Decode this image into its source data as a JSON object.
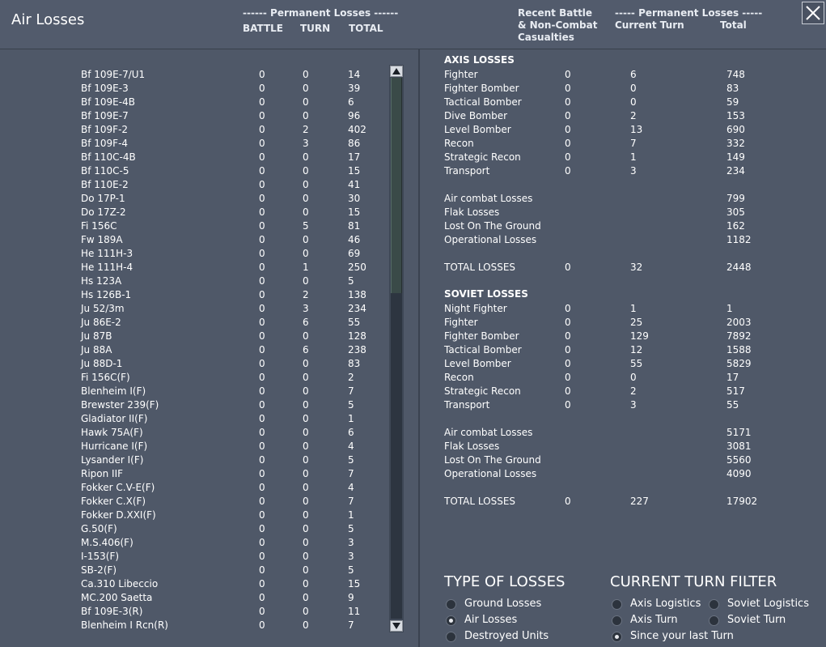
{
  "header": {
    "title": "Air Losses",
    "perm_losses_left": "------ Permanent Losses ------",
    "col_battle": "BATTLE",
    "col_turn": "TURN",
    "col_total": "TOTAL",
    "recent_line1": "Recent Battle",
    "recent_line2": "& Non-Combat",
    "recent_line3": "Casualties",
    "perm_losses_right": "----- Permanent Losses -----",
    "col_current_turn": "Current Turn",
    "col_total_right": "Total"
  },
  "aircraft": [
    {
      "name": "Bf 109E-7/U1",
      "battle": "0",
      "turn": "0",
      "total": "14"
    },
    {
      "name": "Bf 109E-3",
      "battle": "0",
      "turn": "0",
      "total": "39"
    },
    {
      "name": "Bf 109E-4B",
      "battle": "0",
      "turn": "0",
      "total": "6"
    },
    {
      "name": "Bf 109E-7",
      "battle": "0",
      "turn": "0",
      "total": "96"
    },
    {
      "name": "Bf 109F-2",
      "battle": "0",
      "turn": "2",
      "total": "402"
    },
    {
      "name": "Bf 109F-4",
      "battle": "0",
      "turn": "3",
      "total": "86"
    },
    {
      "name": "Bf 110C-4B",
      "battle": "0",
      "turn": "0",
      "total": "17"
    },
    {
      "name": "Bf 110C-5",
      "battle": "0",
      "turn": "0",
      "total": "15"
    },
    {
      "name": "Bf 110E-2",
      "battle": "0",
      "turn": "0",
      "total": "41"
    },
    {
      "name": "Do 17P-1",
      "battle": "0",
      "turn": "0",
      "total": "30"
    },
    {
      "name": "Do 17Z-2",
      "battle": "0",
      "turn": "0",
      "total": "15"
    },
    {
      "name": "Fi 156C",
      "battle": "0",
      "turn": "5",
      "total": "81"
    },
    {
      "name": "Fw 189A",
      "battle": "0",
      "turn": "0",
      "total": "46"
    },
    {
      "name": "He 111H-3",
      "battle": "0",
      "turn": "0",
      "total": "69"
    },
    {
      "name": "He 111H-4",
      "battle": "0",
      "turn": "1",
      "total": "250"
    },
    {
      "name": "Hs 123A",
      "battle": "0",
      "turn": "0",
      "total": "5"
    },
    {
      "name": "Hs 126B-1",
      "battle": "0",
      "turn": "2",
      "total": "138"
    },
    {
      "name": "Ju 52/3m",
      "battle": "0",
      "turn": "3",
      "total": "234"
    },
    {
      "name": "Ju 86E-2",
      "battle": "0",
      "turn": "6",
      "total": "55"
    },
    {
      "name": "Ju 87B",
      "battle": "0",
      "turn": "0",
      "total": "128"
    },
    {
      "name": "Ju 88A",
      "battle": "0",
      "turn": "6",
      "total": "238"
    },
    {
      "name": "Ju 88D-1",
      "battle": "0",
      "turn": "0",
      "total": "83"
    },
    {
      "name": "Fi 156C(F)",
      "battle": "0",
      "turn": "0",
      "total": "2"
    },
    {
      "name": "Blenheim I(F)",
      "battle": "0",
      "turn": "0",
      "total": "7"
    },
    {
      "name": "Brewster 239(F)",
      "battle": "0",
      "turn": "0",
      "total": "5"
    },
    {
      "name": "Gladiator II(F)",
      "battle": "0",
      "turn": "0",
      "total": "1"
    },
    {
      "name": "Hawk 75A(F)",
      "battle": "0",
      "turn": "0",
      "total": "6"
    },
    {
      "name": "Hurricane I(F)",
      "battle": "0",
      "turn": "0",
      "total": "4"
    },
    {
      "name": "Lysander I(F)",
      "battle": "0",
      "turn": "0",
      "total": "5"
    },
    {
      "name": "Ripon IIF",
      "battle": "0",
      "turn": "0",
      "total": "7"
    },
    {
      "name": "Fokker C.V-E(F)",
      "battle": "0",
      "turn": "0",
      "total": "4"
    },
    {
      "name": "Fokker C.X(F)",
      "battle": "0",
      "turn": "0",
      "total": "7"
    },
    {
      "name": "Fokker D.XXI(F)",
      "battle": "0",
      "turn": "0",
      "total": "1"
    },
    {
      "name": "G.50(F)",
      "battle": "0",
      "turn": "0",
      "total": "5"
    },
    {
      "name": "M.S.406(F)",
      "battle": "0",
      "turn": "0",
      "total": "3"
    },
    {
      "name": "I-153(F)",
      "battle": "0",
      "turn": "0",
      "total": "3"
    },
    {
      "name": "SB-2(F)",
      "battle": "0",
      "turn": "0",
      "total": "5"
    },
    {
      "name": "Ca.310 Libeccio",
      "battle": "0",
      "turn": "0",
      "total": "15"
    },
    {
      "name": "MC.200 Saetta",
      "battle": "0",
      "turn": "0",
      "total": "9"
    },
    {
      "name": "Bf 109E-3(R)",
      "battle": "0",
      "turn": "0",
      "total": "11"
    },
    {
      "name": "Blenheim I Rcn(R)",
      "battle": "0",
      "turn": "0",
      "total": "7"
    }
  ],
  "axis": {
    "heading": "AXIS LOSSES",
    "types": [
      {
        "name": "Fighter",
        "recent": "0",
        "turn": "6",
        "total": "748"
      },
      {
        "name": "Fighter Bomber",
        "recent": "0",
        "turn": "0",
        "total": "83"
      },
      {
        "name": "Tactical Bomber",
        "recent": "0",
        "turn": "0",
        "total": "59"
      },
      {
        "name": "Dive Bomber",
        "recent": "0",
        "turn": "2",
        "total": "153"
      },
      {
        "name": "Level Bomber",
        "recent": "0",
        "turn": "13",
        "total": "690"
      },
      {
        "name": "Recon",
        "recent": "0",
        "turn": "7",
        "total": "332"
      },
      {
        "name": "Strategic Recon",
        "recent": "0",
        "turn": "1",
        "total": "149"
      },
      {
        "name": "Transport",
        "recent": "0",
        "turn": "3",
        "total": "234"
      }
    ],
    "causes": [
      {
        "name": "Air combat Losses",
        "total": "799"
      },
      {
        "name": "Flak Losses",
        "total": "305"
      },
      {
        "name": "Lost On The Ground",
        "total": "162"
      },
      {
        "name": "Operational Losses",
        "total": "1182"
      }
    ],
    "totals": {
      "label": "TOTAL LOSSES",
      "recent": "0",
      "turn": "32",
      "total": "2448"
    }
  },
  "soviet": {
    "heading": "SOVIET LOSSES",
    "types": [
      {
        "name": "Night Fighter",
        "recent": "0",
        "turn": "1",
        "total": "1"
      },
      {
        "name": "Fighter",
        "recent": "0",
        "turn": "25",
        "total": "2003"
      },
      {
        "name": "Fighter Bomber",
        "recent": "0",
        "turn": "129",
        "total": "7892"
      },
      {
        "name": "Tactical Bomber",
        "recent": "0",
        "turn": "12",
        "total": "1588"
      },
      {
        "name": "Level Bomber",
        "recent": "0",
        "turn": "55",
        "total": "5829"
      },
      {
        "name": "Recon",
        "recent": "0",
        "turn": "0",
        "total": "17"
      },
      {
        "name": "Strategic Recon",
        "recent": "0",
        "turn": "2",
        "total": "517"
      },
      {
        "name": "Transport",
        "recent": "0",
        "turn": "3",
        "total": "55"
      }
    ],
    "causes": [
      {
        "name": "Air combat Losses",
        "total": "5171"
      },
      {
        "name": "Flak Losses",
        "total": "3081"
      },
      {
        "name": "Lost On The Ground",
        "total": "5560"
      },
      {
        "name": "Operational Losses",
        "total": "4090"
      }
    ],
    "totals": {
      "label": "TOTAL LOSSES",
      "recent": "0",
      "turn": "227",
      "total": "17902"
    }
  },
  "type_of_losses": {
    "heading": "TYPE OF LOSSES",
    "options": [
      {
        "label": "Ground Losses",
        "selected": false
      },
      {
        "label": "Air Losses",
        "selected": true
      },
      {
        "label": "Destroyed Units",
        "selected": false
      }
    ]
  },
  "turn_filter": {
    "heading": "CURRENT TURN FILTER",
    "options": [
      {
        "label": "Axis Logistics",
        "selected": false
      },
      {
        "label": "Soviet Logistics",
        "selected": false
      },
      {
        "label": "Axis Turn",
        "selected": false
      },
      {
        "label": "Soviet Turn",
        "selected": false
      },
      {
        "label": "Since your last Turn",
        "selected": true
      }
    ]
  },
  "icons": {
    "close": "close-icon",
    "scroll_up": "scroll-up-arrow-icon",
    "scroll_down": "scroll-down-arrow-icon"
  }
}
